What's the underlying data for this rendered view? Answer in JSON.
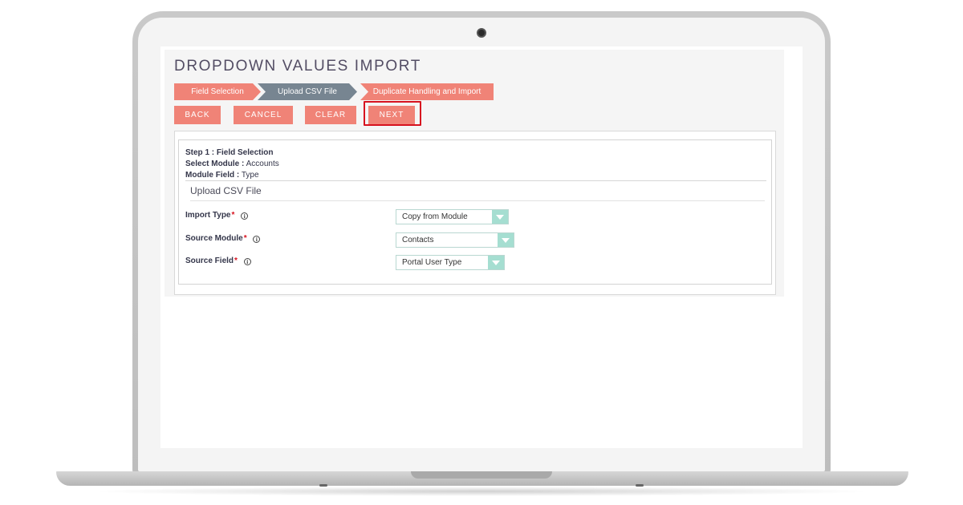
{
  "page": {
    "title": "DROPDOWN VALUES IMPORT"
  },
  "steps": [
    {
      "label": "Field Selection"
    },
    {
      "label": "Upload CSV File"
    },
    {
      "label": "Duplicate Handling and Import"
    }
  ],
  "buttons": {
    "back": "BACK",
    "cancel": "CANCEL",
    "clear": "CLEAR",
    "next": "NEXT"
  },
  "summary": {
    "step_key": "Step 1 : Field Selection",
    "module_key": "Select Module :",
    "module_value": "Accounts",
    "field_key": "Module Field :",
    "field_value": "Type"
  },
  "section": {
    "title": "Upload CSV File"
  },
  "fields": [
    {
      "label": "Import Type",
      "required": "*",
      "value": "Copy from Module"
    },
    {
      "label": "Source Module",
      "required": "*",
      "value": "Contacts"
    },
    {
      "label": "Source Field",
      "required": "*",
      "value": "Portal User Type"
    }
  ],
  "info_glyph": "i",
  "colors": {
    "accent": "#f08377",
    "active_step": "#778591",
    "highlight": "#d7121f",
    "select_arrow": "#a5ded1"
  }
}
